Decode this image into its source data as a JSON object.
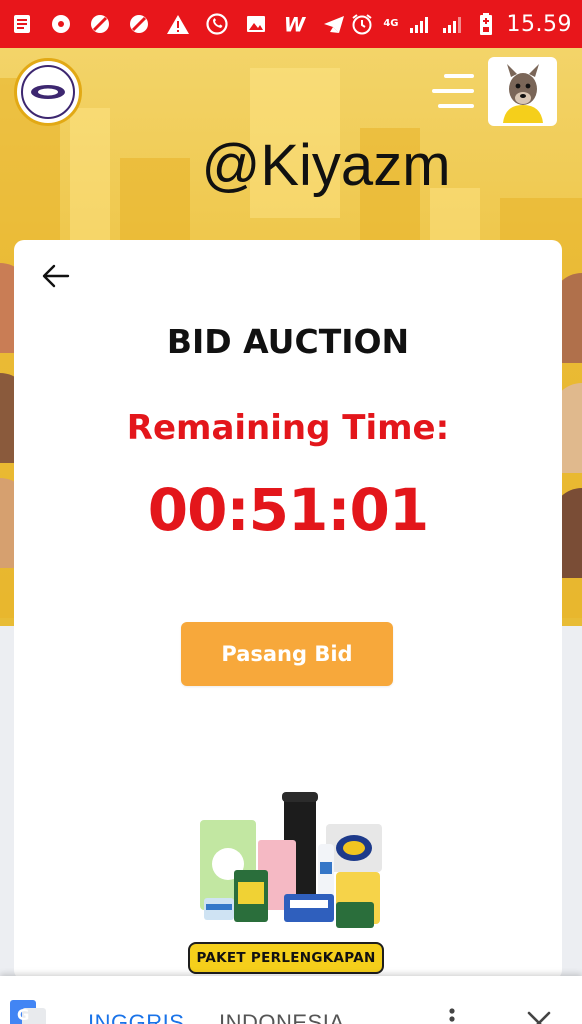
{
  "status_bar": {
    "time": "15.59",
    "network": "4G",
    "left_icons": [
      "notes-icon",
      "messenger-icon",
      "blocked-icon",
      "blocked-icon",
      "warning-icon",
      "whatsapp-icon",
      "gallery-icon",
      "w-app-icon",
      "telegram-icon"
    ],
    "right_icons": [
      "alarm-icon",
      "signal-icon",
      "signal-icon",
      "battery-low-icon"
    ]
  },
  "header": {
    "username": "@Kiyazm",
    "avatar_icon": "mascot-avatar-icon",
    "menu_icon": "hamburger-menu-icon"
  },
  "auction": {
    "title": "BID AUCTION",
    "remaining_label": "Remaining Time:",
    "countdown": "00:51:01",
    "bid_button_label": "Pasang Bid",
    "product_banner": "PAKET PERLENGKAPAN"
  },
  "translate_bar": {
    "tabs": [
      {
        "label": "INGGRIS",
        "active": true
      },
      {
        "label": "INDONESIA",
        "active": false
      }
    ]
  },
  "colors": {
    "status_bar": "#e8161b",
    "accent_red": "#e3161b",
    "bid_button": "#f7a83b",
    "hero_yellow": "#eec547",
    "translate_active": "#1a73e8"
  }
}
